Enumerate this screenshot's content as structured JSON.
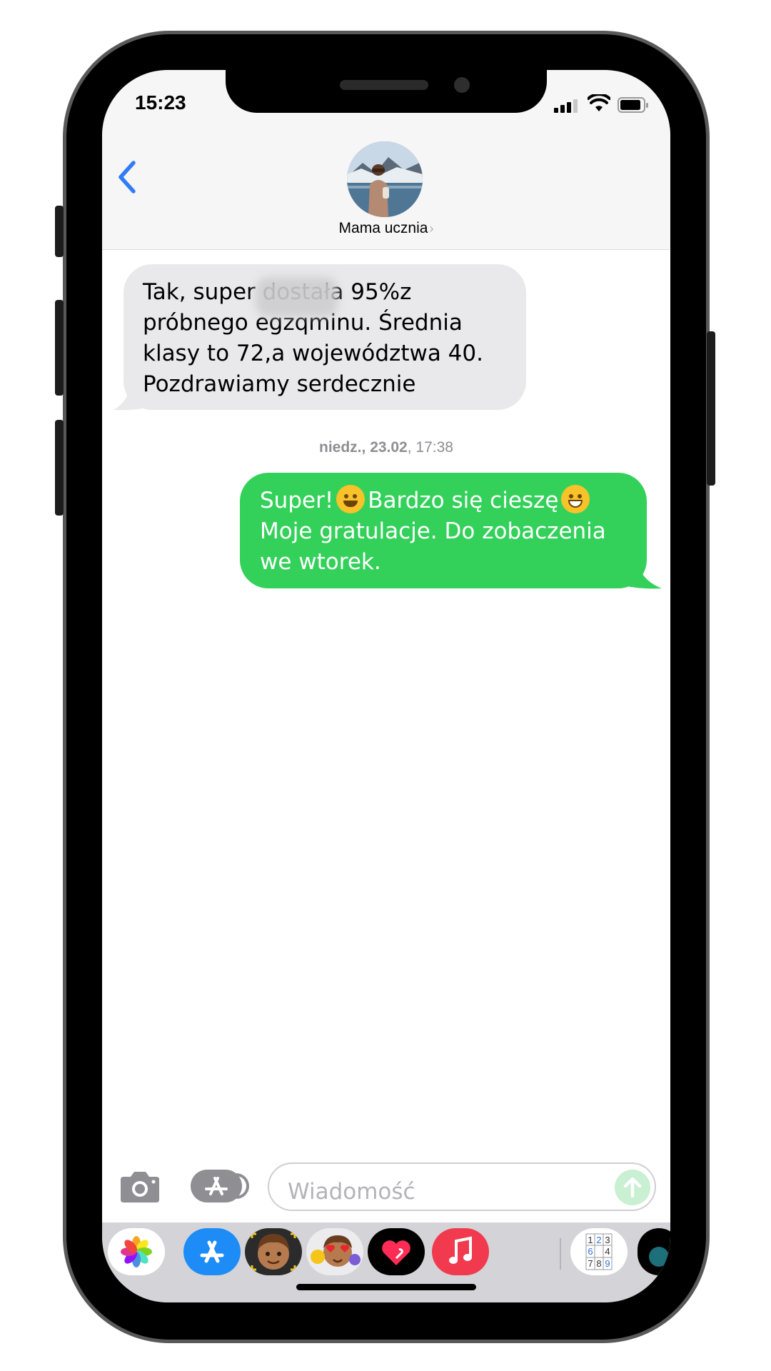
{
  "status_bar": {
    "time": "15:23"
  },
  "header": {
    "contact_name": "Mama ucznia",
    "contact_chevron": "›",
    "back_icon": "chevron-left-icon",
    "avatar_icon": "contact-avatar-photo"
  },
  "conversation": {
    "messages": [
      {
        "direction": "incoming",
        "text": "Tak, super       dostała 95%z\npróbnego egzqminu. Średnia\nklasy to 72,a województwa 40.\nPozdrawiamy serdecznie",
        "redacted": true
      },
      {
        "direction": "outgoing",
        "line1_a": "Super!",
        "line1_b": "Bardzo się cieszę",
        "line2": "Moje gratulacje. Do zobaczenia",
        "line3": "we wtorek.",
        "emoji": [
          "smiling-face-icon",
          "grinning-face-icon"
        ]
      }
    ],
    "timestamp_day": "niedz., 23.02",
    "timestamp_time": ", 17:38"
  },
  "input_bar": {
    "placeholder": "Wiadomość",
    "camera_icon": "camera-icon",
    "apps_icon": "app-store-icon",
    "send_icon": "arrow-up-icon"
  },
  "app_drawer": {
    "apps": [
      "photos-icon",
      "app-store-icon",
      "memoji-icon",
      "memoji-stickers-icon",
      "digital-touch-icon",
      "music-icon",
      "sudoku-icon",
      "more-app-icon"
    ],
    "sudoku_digits": [
      "1",
      "2",
      "3",
      "6",
      "4",
      "7",
      "8",
      "9"
    ]
  },
  "colors": {
    "outgoing_bubble": "#34d15a",
    "incoming_bubble": "#e9e9eb",
    "accent_blue": "#2f7cf6",
    "send_button_disabled": "#c9f0d2"
  }
}
